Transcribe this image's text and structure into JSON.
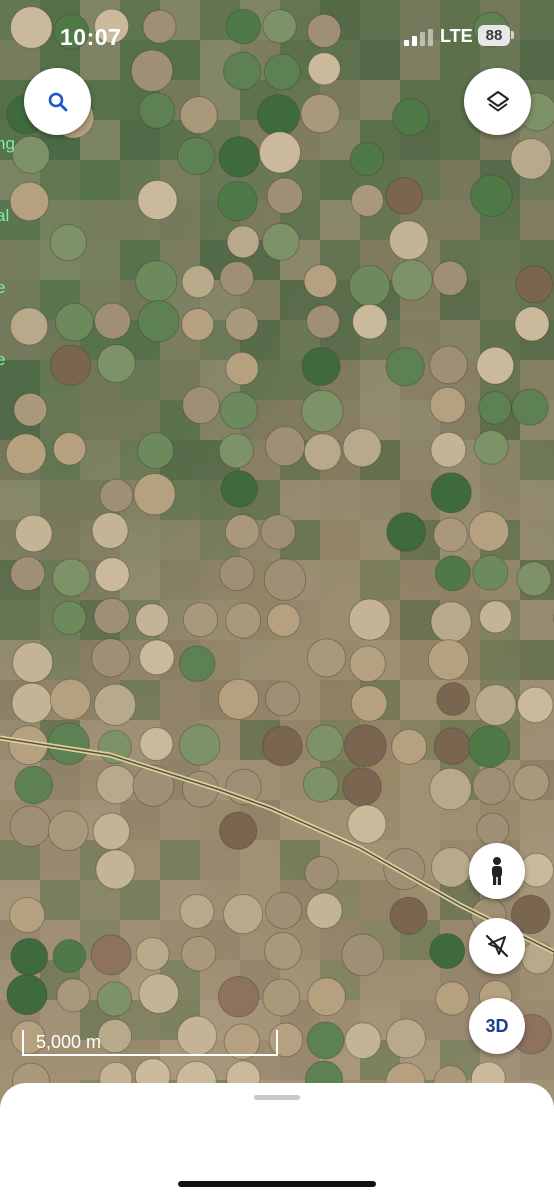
{
  "status_bar": {
    "time": "10:07",
    "network": "LTE",
    "battery": "88"
  },
  "map": {
    "type": "satellite",
    "edge_text": [
      "ng",
      "al",
      "e",
      "e"
    ],
    "scale_label": "5,000 m"
  },
  "controls": {
    "search_icon": "search-icon",
    "layers_icon": "layers-icon",
    "person_icon": "street-view-person-icon",
    "compass_icon": "location-off-icon",
    "three_d_label": "3D"
  },
  "colors": {
    "accent": "#1a3f8f",
    "button_bg": "#ffffff",
    "road": "#d8cf9a"
  }
}
